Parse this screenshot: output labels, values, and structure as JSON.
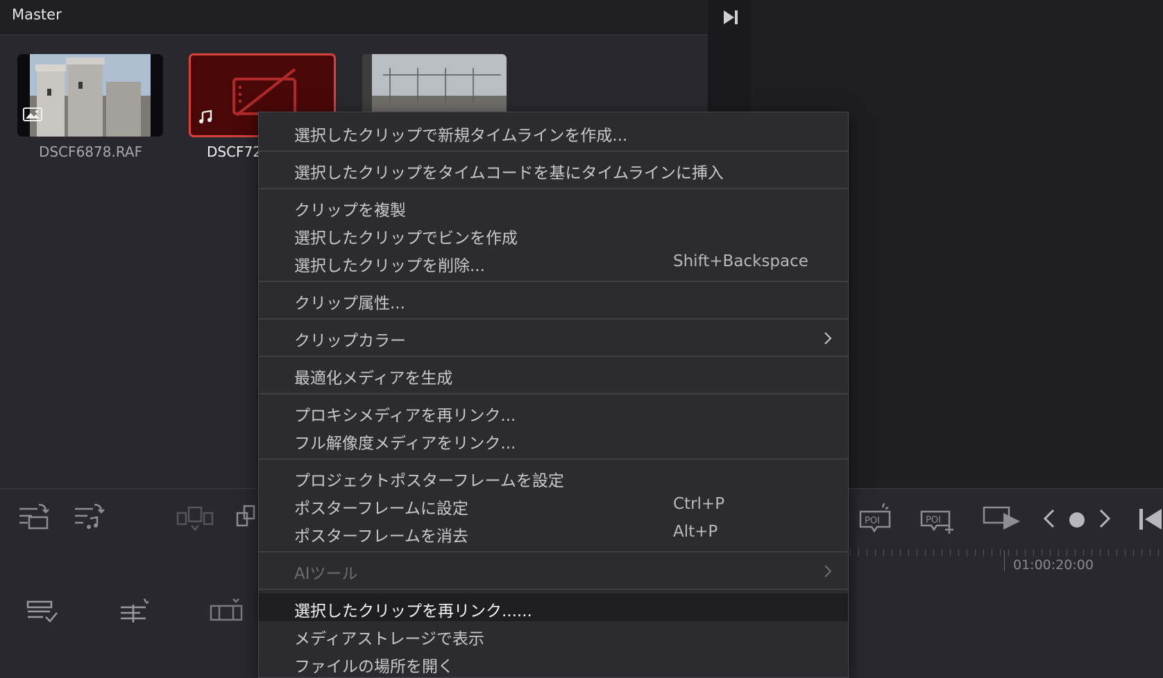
{
  "bin": {
    "title": "Master",
    "clips": [
      {
        "name": "DSCF6878.RAF",
        "type": "image"
      },
      {
        "name": "DSCF72",
        "type": "audio",
        "selected": true
      },
      {
        "name": "",
        "type": "video"
      }
    ]
  },
  "timeline": {
    "timecode": "01:00:20:00"
  },
  "menu": {
    "items": [
      {
        "label": "選択したクリップで新規タイムラインを作成...",
        "shortcut": ""
      },
      {
        "label": "選択したクリップをタイムコードを基にタイムラインに挿入",
        "shortcut": ""
      },
      {
        "label": "クリップを複製",
        "shortcut": ""
      },
      {
        "label": "選択したクリップでビンを作成",
        "shortcut": ""
      },
      {
        "label": "選択したクリップを削除...",
        "shortcut": "Shift+Backspace"
      },
      {
        "label": "クリップ属性...",
        "shortcut": ""
      },
      {
        "label": "クリップカラー",
        "shortcut": "",
        "submenu": true
      },
      {
        "label": "最適化メディアを生成",
        "shortcut": ""
      },
      {
        "label": "プロキシメディアを再リンク...",
        "shortcut": ""
      },
      {
        "label": "フル解像度メディアをリンク...",
        "shortcut": ""
      },
      {
        "label": "プロジェクトポスターフレームを設定",
        "shortcut": ""
      },
      {
        "label": "ポスターフレームに設定",
        "shortcut": "Ctrl+P"
      },
      {
        "label": "ポスターフレームを消去",
        "shortcut": "Alt+P"
      },
      {
        "label": "AIツール",
        "shortcut": "",
        "submenu": true,
        "disabled": true
      },
      {
        "label": "選択したクリップを再リンク......",
        "shortcut": "",
        "highlighted": true
      },
      {
        "label": "メディアストレージで表示",
        "shortcut": ""
      },
      {
        "label": "ファイルの場所を開く",
        "shortcut": ""
      }
    ]
  },
  "colors": {
    "selection_border": "#d9423a",
    "audio_clip_bg": "#4a0707",
    "menu_bg": "#2b2b30"
  }
}
